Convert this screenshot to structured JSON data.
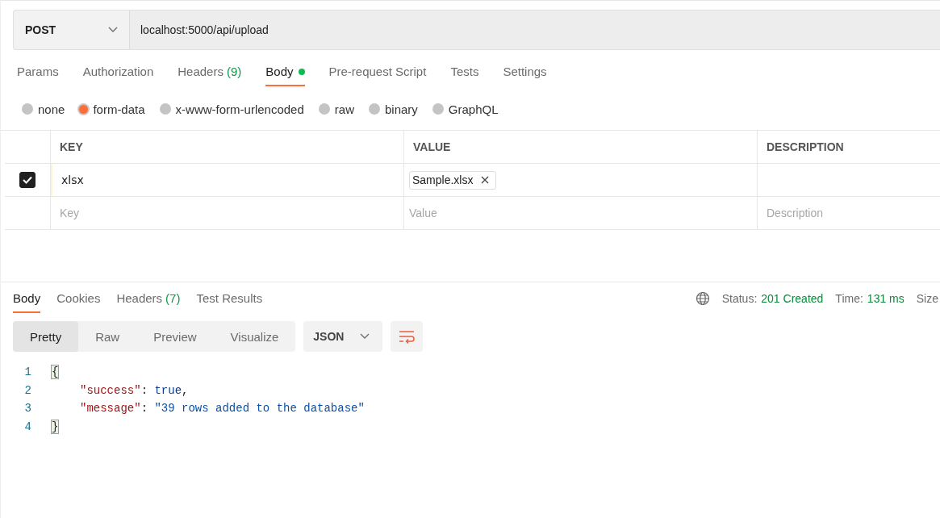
{
  "request": {
    "method": "POST",
    "url": "localhost:5000/api/upload"
  },
  "request_tabs": [
    {
      "label": "Params",
      "selected": false
    },
    {
      "label": "Authorization",
      "selected": false
    },
    {
      "label": "Headers",
      "count": "(9)",
      "selected": false
    },
    {
      "label": "Body",
      "selected": true,
      "dot": true
    },
    {
      "label": "Pre-request Script",
      "selected": false
    },
    {
      "label": "Tests",
      "selected": false
    },
    {
      "label": "Settings",
      "selected": false
    }
  ],
  "body_types": [
    {
      "label": "none",
      "selected": false
    },
    {
      "label": "form-data",
      "selected": true
    },
    {
      "label": "x-www-form-urlencoded",
      "selected": false
    },
    {
      "label": "raw",
      "selected": false
    },
    {
      "label": "binary",
      "selected": false
    },
    {
      "label": "GraphQL",
      "selected": false
    }
  ],
  "table": {
    "columns": [
      "KEY",
      "VALUE",
      "DESCRIPTION"
    ],
    "rows": [
      {
        "checked": true,
        "key": "xlsx",
        "file": "Sample.xlsx"
      }
    ],
    "new_row": {
      "key_placeholder": "Key",
      "value_placeholder": "Value",
      "description_placeholder": "Description"
    }
  },
  "response_tabs": [
    {
      "label": "Body",
      "selected": true
    },
    {
      "label": "Cookies",
      "selected": false
    },
    {
      "label": "Headers",
      "count": "(7)",
      "selected": false
    },
    {
      "label": "Test Results",
      "selected": false
    }
  ],
  "status": {
    "status_label": "Status:",
    "status_value": "201 Created",
    "time_label": "Time:",
    "time_value": "131 ms",
    "size_label": "Size"
  },
  "view_modes": [
    {
      "label": "Pretty",
      "selected": true
    },
    {
      "label": "Raw",
      "selected": false
    },
    {
      "label": "Preview",
      "selected": false
    },
    {
      "label": "Visualize",
      "selected": false
    }
  ],
  "format": "JSON",
  "code_lines": [
    {
      "number": "1",
      "indented": false,
      "tokens": [
        {
          "kind": "brace",
          "text": "{"
        }
      ]
    },
    {
      "number": "2",
      "indented": true,
      "tokens": [
        {
          "kind": "key",
          "text": "\"success\""
        },
        {
          "kind": "punct",
          "text": ": "
        },
        {
          "kind": "bool",
          "text": "true"
        },
        {
          "kind": "punct",
          "text": ","
        }
      ]
    },
    {
      "number": "3",
      "indented": true,
      "tokens": [
        {
          "kind": "key",
          "text": "\"message\""
        },
        {
          "kind": "punct",
          "text": ": "
        },
        {
          "kind": "string",
          "text": "\"39 rows added to the database\""
        }
      ]
    },
    {
      "number": "4",
      "indented": false,
      "tokens": [
        {
          "kind": "brace",
          "text": "}"
        }
      ]
    }
  ]
}
